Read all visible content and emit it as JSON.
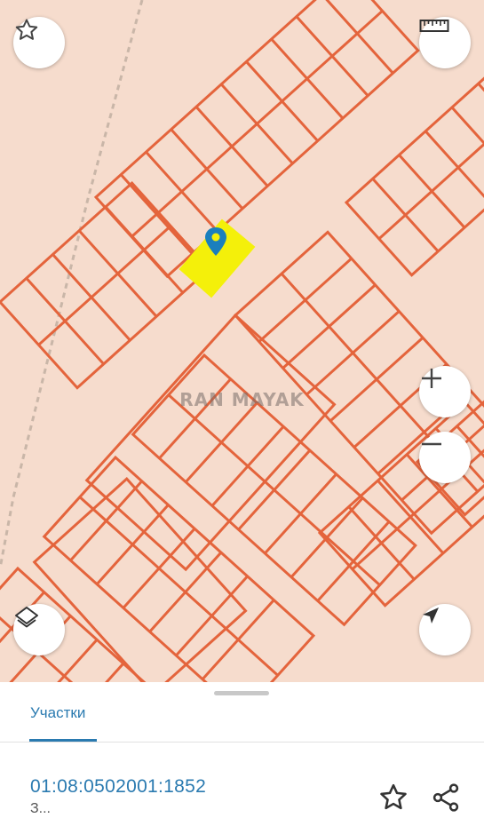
{
  "map": {
    "watermark": "RAN MAYAK",
    "colors": {
      "background": "#f6dccd",
      "plot_border": "#e4643c",
      "selected_plot": "#f4f00a",
      "marker": "#1b7fbd"
    },
    "controls": {
      "favorite_icon": "star-outline-icon",
      "ruler_icon": "ruler-icon",
      "zoom_in_icon": "plus-icon",
      "zoom_out_icon": "minus-icon",
      "layers_icon": "layers-icon",
      "locate_icon": "navigation-arrow-icon"
    }
  },
  "sheet": {
    "tab_label": "Участки",
    "cadastral_number": "01:08:0502001:1852",
    "subtitle": "З...",
    "favorite_icon": "star-outline-icon",
    "share_icon": "share-icon"
  }
}
